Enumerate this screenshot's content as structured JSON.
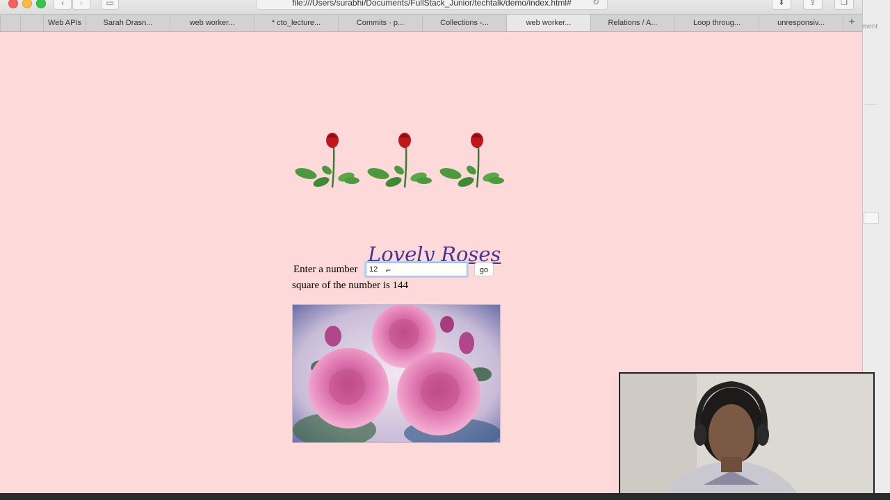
{
  "browser": {
    "url": "file:///Users/surabhi/Documents/FullStack_Junior/techtalk/demo/index.html#",
    "tabs": [
      {
        "label": "Web APIs"
      },
      {
        "label": "Sarah Drasn..."
      },
      {
        "label": "web worker..."
      },
      {
        "label": "* cto_lecture..."
      },
      {
        "label": "Commits · p..."
      },
      {
        "label": "Collections -..."
      },
      {
        "label": "web worker...",
        "active": true
      },
      {
        "label": "Relations / A..."
      },
      {
        "label": "Loop throug..."
      },
      {
        "label": "unresponsiv..."
      }
    ],
    "new_tab_label": "+"
  },
  "page": {
    "title": "Lovely Roses",
    "form": {
      "label": "Enter a number",
      "input_value": "12",
      "button_label": "go"
    },
    "result_text": "square of the number is 144"
  },
  "side": {
    "partial_text": "ment"
  },
  "colors": {
    "page_background": "#fdd9d9",
    "title_color": "#4a3396"
  },
  "icons": [
    "back-arrow-icon",
    "forward-arrow-icon",
    "sidebar-icon",
    "reload-icon",
    "download-icon",
    "share-icon",
    "tabs-icon",
    "rose-sprite-icon",
    "text-cursor-icon"
  ]
}
